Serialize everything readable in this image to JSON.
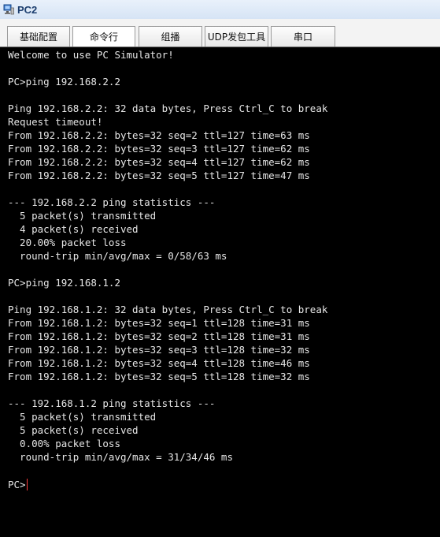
{
  "window": {
    "title": "PC2"
  },
  "tabs": [
    {
      "label": "基础配置",
      "active": false
    },
    {
      "label": "命令行",
      "active": true
    },
    {
      "label": "组播",
      "active": false
    },
    {
      "label": "UDP发包工具",
      "active": false
    },
    {
      "label": "串口",
      "active": false
    }
  ],
  "terminal": {
    "lines": [
      "Welcome to use PC Simulator!",
      "",
      "PC>ping 192.168.2.2",
      "",
      "Ping 192.168.2.2: 32 data bytes, Press Ctrl_C to break",
      "Request timeout!",
      "From 192.168.2.2: bytes=32 seq=2 ttl=127 time=63 ms",
      "From 192.168.2.2: bytes=32 seq=3 ttl=127 time=62 ms",
      "From 192.168.2.2: bytes=32 seq=4 ttl=127 time=62 ms",
      "From 192.168.2.2: bytes=32 seq=5 ttl=127 time=47 ms",
      "",
      "--- 192.168.2.2 ping statistics ---",
      "  5 packet(s) transmitted",
      "  4 packet(s) received",
      "  20.00% packet loss",
      "  round-trip min/avg/max = 0/58/63 ms",
      "",
      "PC>ping 192.168.1.2",
      "",
      "Ping 192.168.1.2: 32 data bytes, Press Ctrl_C to break",
      "From 192.168.1.2: bytes=32 seq=1 ttl=128 time=31 ms",
      "From 192.168.1.2: bytes=32 seq=2 ttl=128 time=31 ms",
      "From 192.168.1.2: bytes=32 seq=3 ttl=128 time=32 ms",
      "From 192.168.1.2: bytes=32 seq=4 ttl=128 time=46 ms",
      "From 192.168.1.2: bytes=32 seq=5 ttl=128 time=32 ms",
      "",
      "--- 192.168.1.2 ping statistics ---",
      "  5 packet(s) transmitted",
      "  5 packet(s) received",
      "  0.00% packet loss",
      "  round-trip min/avg/max = 31/34/46 ms",
      ""
    ],
    "prompt": "PC>"
  },
  "colors": {
    "terminal_bg": "#000000",
    "terminal_text": "#e6e6e6",
    "cursor": "#ff3b3b",
    "title_text": "#1c3e6e"
  },
  "icons": {
    "app_icon": "pc-simulator-icon"
  }
}
